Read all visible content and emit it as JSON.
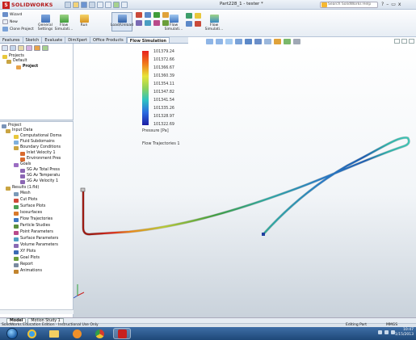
{
  "titlebar": {
    "logo_text": "SOLIDWORKS",
    "window_title": "Part228_1 - tester *",
    "search_placeholder": "Search SolidWorks Help",
    "window_controls": [
      "?",
      "–",
      "▭",
      "x"
    ]
  },
  "ribbon": {
    "buttons": [
      {
        "label": "Wizard",
        "icon": "wizard-icon"
      },
      {
        "label": "New",
        "icon": "new-project-icon"
      },
      {
        "label": "Clone Project",
        "icon": "clone-project-icon"
      },
      {
        "label": "General Settings",
        "icon": "general-settings-icon"
      },
      {
        "label": "Flow Simulati...",
        "icon": "flow-simulation-icon"
      },
      {
        "label": "Run",
        "icon": "run-icon"
      },
      {
        "label": "Load/Unload",
        "icon": "load-unload-icon"
      },
      {
        "label": "Flow Simulati...",
        "icon": "flow-simulation-icon"
      },
      {
        "label": "Flow Simulati...",
        "icon": "flow-simulation-icon"
      }
    ]
  },
  "tabs": [
    {
      "label": "Features",
      "active": false
    },
    {
      "label": "Sketch",
      "active": false
    },
    {
      "label": "Evaluate",
      "active": false
    },
    {
      "label": "DimXpert",
      "active": false
    },
    {
      "label": "Office Products",
      "active": false
    },
    {
      "label": "Flow Simulation",
      "active": true
    }
  ],
  "tree_top": {
    "items": [
      {
        "label": "Projects",
        "indent": 0
      },
      {
        "label": "Default",
        "indent": 1
      },
      {
        "label": "Project",
        "indent": 2
      }
    ]
  },
  "tree": {
    "items": [
      {
        "label": "Project",
        "indent": 0,
        "color": "#7a93b7"
      },
      {
        "label": "Input Data",
        "indent": 1,
        "color": "#c9a442"
      },
      {
        "label": "Computational Doma",
        "indent": 2,
        "color": "#e8c73a"
      },
      {
        "label": "Fluid Subdomains",
        "indent": 2,
        "color": "#7fb0de"
      },
      {
        "label": "Boundary Conditions",
        "indent": 2,
        "color": "#c9a442"
      },
      {
        "label": "Inlet Velocity 1",
        "indent": 3,
        "color": "#d86a2e"
      },
      {
        "label": "Environment Pres",
        "indent": 3,
        "color": "#d86a2e"
      },
      {
        "label": "Goals",
        "indent": 2,
        "color": "#9b6dc2"
      },
      {
        "label": "SG Av Total Press",
        "indent": 3,
        "color": "#8b66b3"
      },
      {
        "label": "SG Av Temperatu",
        "indent": 3,
        "color": "#8b66b3"
      },
      {
        "label": "SG Av Velocity 1",
        "indent": 3,
        "color": "#8b66b3"
      },
      {
        "label": "Results (1.fld)",
        "indent": 1,
        "color": "#c9a442"
      },
      {
        "label": "Mesh",
        "indent": 2,
        "color": "#7a9ab8"
      },
      {
        "label": "Cut Plots",
        "indent": 2,
        "color": "#cf4a3a"
      },
      {
        "label": "Surface Plots",
        "indent": 2,
        "color": "#4a9f56"
      },
      {
        "label": "Isosurfaces",
        "indent": 2,
        "color": "#d97a2b"
      },
      {
        "label": "Flow Trajectories",
        "indent": 2,
        "color": "#3e78c2"
      },
      {
        "label": "Particle Studies",
        "indent": 2,
        "color": "#5a8f3d"
      },
      {
        "label": "Point Parameters",
        "indent": 2,
        "color": "#b94a8a"
      },
      {
        "label": "Surface Parameters",
        "indent": 2,
        "color": "#4f9ec2"
      },
      {
        "label": "Volume Parameters",
        "indent": 2,
        "color": "#8a6ab3"
      },
      {
        "label": "XY Plots",
        "indent": 2,
        "color": "#3b6ab3"
      },
      {
        "label": "Goal Plots",
        "indent": 2,
        "color": "#6a9e3a"
      },
      {
        "label": "Report",
        "indent": 2,
        "color": "#7a8aa0"
      },
      {
        "label": "Animations",
        "indent": 2,
        "color": "#c2842e"
      }
    ]
  },
  "legend": {
    "values": [
      "101379.24",
      "101372.66",
      "101366.67",
      "101360.39",
      "101354.11",
      "101347.82",
      "101341.54",
      "101335.26",
      "101328.97",
      "101322.69"
    ],
    "unit_label": "Pressure [Pa]",
    "plot_label": "Flow Trajectories 1"
  },
  "bottom_tabs": [
    {
      "label": "Model",
      "active": true
    },
    {
      "label": "Motion Study 1",
      "active": false
    }
  ],
  "status": {
    "left": "SolidWorks Education Edition - Instructional Use Only",
    "mode": "Editing Part",
    "units": "MMGS"
  },
  "taskbar": {
    "time": "10:47",
    "date": "1/15/2013"
  }
}
